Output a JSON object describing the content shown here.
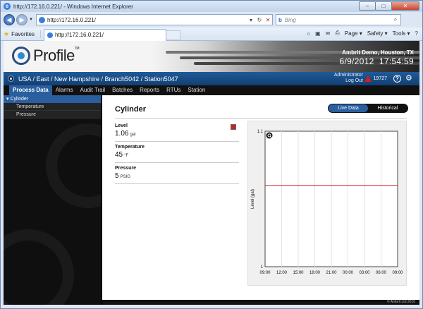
{
  "browser": {
    "window_title": "http://172.16.0.221/ - Windows Internet Explorer",
    "address": "http://172.16.0.221/",
    "search_placeholder": "Bing",
    "favorites_label": "Favorites",
    "tab_label": "http://172.16.0.221/",
    "commands": {
      "page": "Page ▾",
      "safety": "Safety ▾",
      "tools": "Tools ▾"
    }
  },
  "app": {
    "brand": "Profile",
    "trademark": "TM",
    "site": "Ambrit Demo, Houston, TX",
    "date": "6/9/2012",
    "time": "17:54:59",
    "breadcrumb": "USA / East / New Hampshire / Branch5042 / Station5047",
    "user": "Administrator",
    "logout": "Log Out",
    "alarm_count": "19727",
    "footer": "© Ambrit Ltd 2010"
  },
  "menu": [
    {
      "label": "Process Data",
      "active": true
    },
    {
      "label": "Alarms"
    },
    {
      "label": "Audit Trail"
    },
    {
      "label": "Batches"
    },
    {
      "label": "Reports"
    },
    {
      "label": "RTUs"
    },
    {
      "label": "Station"
    }
  ],
  "sidebar": {
    "section": "Cylinder",
    "items": [
      {
        "label": "Temperature"
      },
      {
        "label": "Pressure"
      }
    ]
  },
  "main": {
    "title": "Cylinder",
    "toggle": {
      "live": "Live Data",
      "historical": "Historical"
    },
    "readings": [
      {
        "label": "Level",
        "value": "1.06",
        "unit": "gal"
      },
      {
        "label": "Temperature",
        "value": "45",
        "unit": "°F"
      },
      {
        "label": "Pressure",
        "value": "5",
        "unit": "PSIG"
      }
    ]
  },
  "chart_data": {
    "type": "line",
    "ylabel": "Level (gal)",
    "ylim": [
      1,
      1.1
    ],
    "y_ticks": [
      "1.1",
      "1"
    ],
    "x_ticks": [
      "09:00",
      "12:00",
      "15:00",
      "18:00",
      "21:00",
      "00:00",
      "03:00",
      "06:00",
      "09:00"
    ],
    "series": [
      {
        "values": [
          1.06,
          1.06
        ]
      }
    ],
    "colors": {
      "line": "#d21f1f",
      "grid": "#e2e2e2"
    }
  }
}
